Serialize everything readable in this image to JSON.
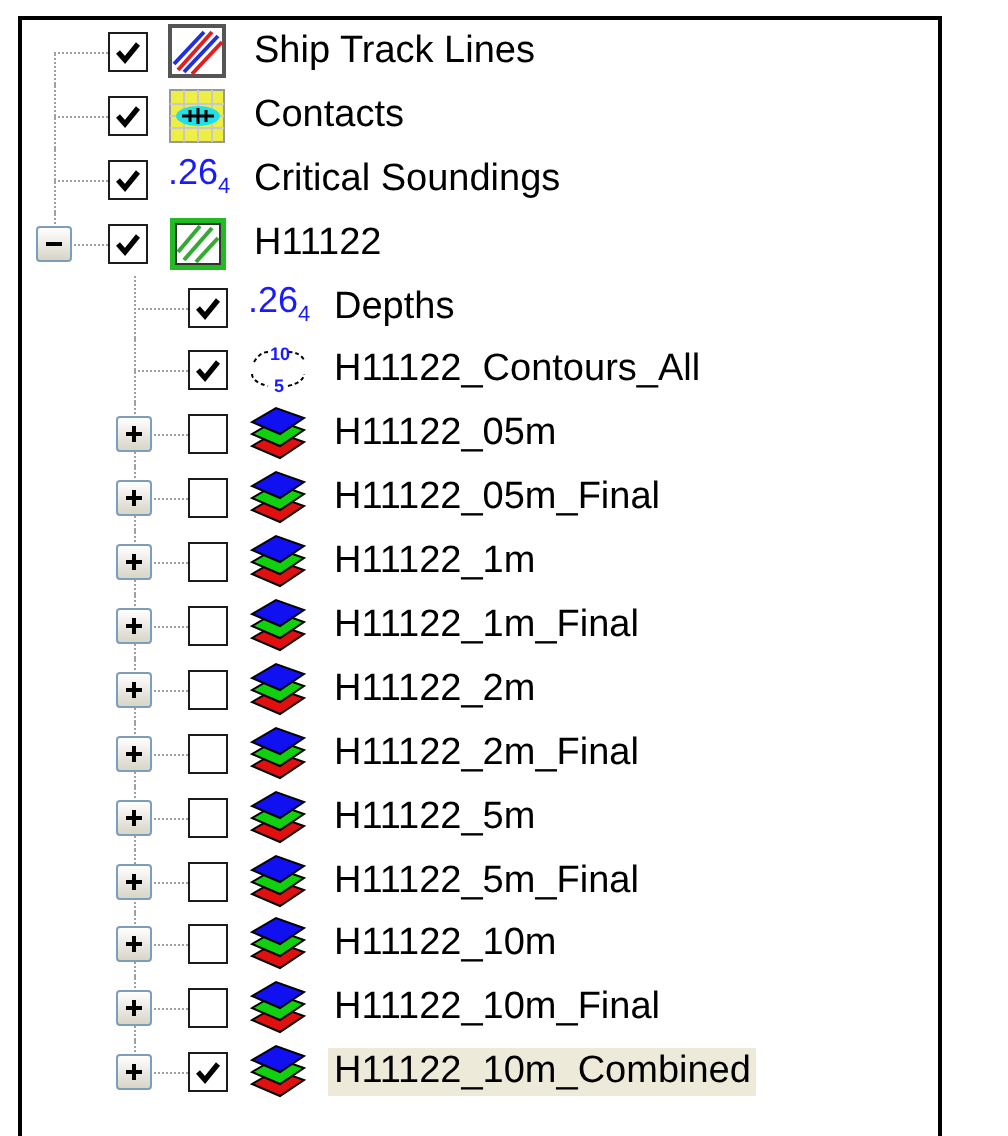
{
  "tree": [
    {
      "label": "Ship Track Lines",
      "kind": "track-lines",
      "checked": true,
      "selected": false
    },
    {
      "label": "Contacts",
      "kind": "contacts",
      "checked": true,
      "selected": false
    },
    {
      "label": "Critical Soundings",
      "kind": "soundings",
      "icon_label": ".26$_{4}$",
      "checked": true,
      "selected": false
    },
    {
      "label": "H11122",
      "kind": "survey",
      "checked": true,
      "selected": false,
      "expanded": true,
      "children": [
        {
          "label": "Depths",
          "kind": "soundings",
          "icon_label": ".26$_{4}$",
          "checked": true,
          "selected": false
        },
        {
          "label": "H11122_Contours_All",
          "kind": "contours",
          "icon_labels": [
            "10",
            "5"
          ],
          "checked": true,
          "selected": false
        },
        {
          "label": "H11122_05m",
          "kind": "surface",
          "checked": false,
          "selected": false,
          "expanded": false
        },
        {
          "label": "H11122_05m_Final",
          "kind": "surface",
          "checked": false,
          "selected": false,
          "expanded": false
        },
        {
          "label": "H11122_1m",
          "kind": "surface",
          "checked": false,
          "selected": false,
          "expanded": false
        },
        {
          "label": "H11122_1m_Final",
          "kind": "surface",
          "checked": false,
          "selected": false,
          "expanded": false
        },
        {
          "label": "H11122_2m",
          "kind": "surface",
          "checked": false,
          "selected": false,
          "expanded": false
        },
        {
          "label": "H11122_2m_Final",
          "kind": "surface",
          "checked": false,
          "selected": false,
          "expanded": false
        },
        {
          "label": "H11122_5m",
          "kind": "surface",
          "checked": false,
          "selected": false,
          "expanded": false
        },
        {
          "label": "H11122_5m_Final",
          "kind": "surface",
          "checked": false,
          "selected": false,
          "expanded": false
        },
        {
          "label": "H11122_10m",
          "kind": "surface",
          "checked": false,
          "selected": false,
          "expanded": false
        },
        {
          "label": "H11122_10m_Final",
          "kind": "surface",
          "checked": false,
          "selected": false,
          "expanded": false
        },
        {
          "label": "H11122_10m_Combined",
          "kind": "surface",
          "checked": true,
          "selected": true,
          "expanded": false
        }
      ]
    }
  ]
}
